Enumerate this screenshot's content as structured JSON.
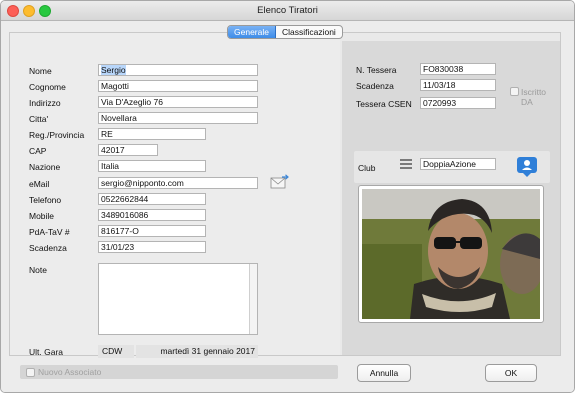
{
  "window": {
    "title": "Elenco Tiratori"
  },
  "tabs": [
    {
      "label": "Generale",
      "active": true
    },
    {
      "label": "Classificazioni",
      "active": false
    }
  ],
  "form": {
    "nome": {
      "label": "Nome",
      "value": "Sergio"
    },
    "cognome": {
      "label": "Cognome",
      "value": "Magotti"
    },
    "indirizzo": {
      "label": "Indirizzo",
      "value": "Via D'Azeglio 76"
    },
    "citta": {
      "label": "Citta'",
      "value": "Novellara"
    },
    "provincia": {
      "label": "Reg./Provincia",
      "value": "RE"
    },
    "cap": {
      "label": "CAP",
      "value": "42017"
    },
    "nazione": {
      "label": "Nazione",
      "value": "Italia"
    },
    "email": {
      "label": "eMail",
      "value": "sergio@nipponto.com"
    },
    "telefono": {
      "label": "Telefono",
      "value": "0522662844"
    },
    "mobile": {
      "label": "Mobile",
      "value": "3489016086"
    },
    "pda_tav": {
      "label": "PdA-TaV #",
      "value": "816177-O"
    },
    "scadenza": {
      "label": "Scadenza",
      "value": "31/01/23"
    },
    "note": {
      "label": "Note",
      "value": ""
    },
    "ult_gara": {
      "label": "Ult. Gara",
      "code": "CDW",
      "date": "martedì 31 gennaio 2017"
    }
  },
  "right": {
    "tessera": {
      "label": "N. Tessera",
      "value": "FO830038"
    },
    "scadenza": {
      "label": "Scadenza",
      "value": "11/03/18"
    },
    "iscritto_da": {
      "label": "Iscritto DA",
      "checked": false
    },
    "tessera_csen": {
      "label": "Tessera CSEN",
      "value": "0720993"
    },
    "club": {
      "label": "Club",
      "value": "DoppiaAzione"
    }
  },
  "bottom": {
    "nuovo_associato": {
      "label": "Nuovo Associato",
      "checked": false
    },
    "cancel_label": "Annulla",
    "ok_label": "OK"
  },
  "colors": {
    "accent": "#3e8ce8",
    "selection": "#b8d6fa"
  }
}
